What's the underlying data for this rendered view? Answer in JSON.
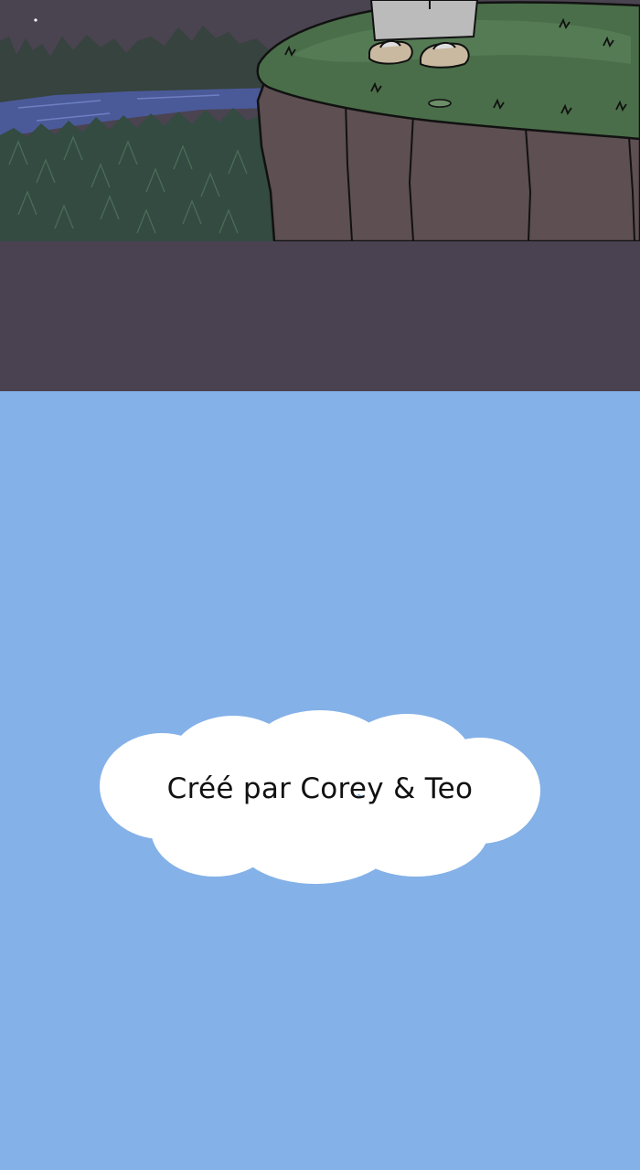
{
  "scene": {
    "description_icon": "night-cliff-scene-icon",
    "colors": {
      "night_sky": "#4A4350",
      "forest_far": "#36433E",
      "forest_near": "#334B41",
      "river": "#4A5A99",
      "cliff_top": "#4A6E49",
      "cliff_face": "#5E4F52",
      "robe": "#BBBBBB"
    }
  },
  "separator": {
    "color": "#4A4251"
  },
  "credits": {
    "background": "#84B1E8",
    "cloud_color": "#FFFFFF",
    "text": "Créé par Corey & Teo"
  }
}
